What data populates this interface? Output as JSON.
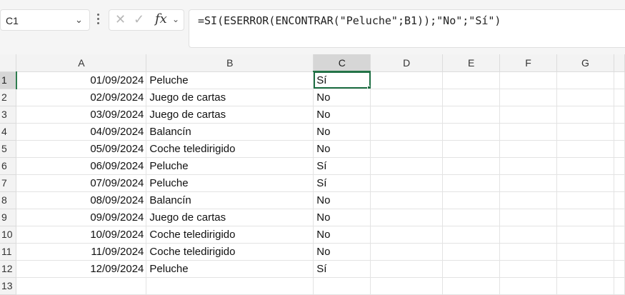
{
  "name_box": {
    "value": "C1",
    "chevron_icon": "chevron-down-icon"
  },
  "formula_controls": {
    "cancel_icon": "x-icon",
    "enter_icon": "checkmark-icon",
    "function_label": "fx",
    "chevron_icon": "chevron-down-icon"
  },
  "formula_bar": {
    "value": "=SI(ESERROR(ENCONTRAR(\"Peluche\";B1));\"No\";\"Sí\")"
  },
  "columns": [
    "A",
    "B",
    "C",
    "D",
    "E",
    "F",
    "G"
  ],
  "selected_column": "C",
  "selected_row": "1",
  "active_cell": "C1",
  "colors": {
    "selection_green": "#1e6e43",
    "header_bg": "#f3f3f3",
    "header_selected_bg": "#d6d6d6"
  },
  "rows": [
    {
      "num": "1",
      "A": "01/09/2024",
      "B": "Peluche",
      "C": "Sí"
    },
    {
      "num": "2",
      "A": "02/09/2024",
      "B": "Juego de cartas",
      "C": "No"
    },
    {
      "num": "3",
      "A": "03/09/2024",
      "B": "Juego de cartas",
      "C": "No"
    },
    {
      "num": "4",
      "A": "04/09/2024",
      "B": "Balancín",
      "C": "No"
    },
    {
      "num": "5",
      "A": "05/09/2024",
      "B": "Coche teledirigido",
      "C": "No"
    },
    {
      "num": "6",
      "A": "06/09/2024",
      "B": "Peluche",
      "C": "Sí"
    },
    {
      "num": "7",
      "A": "07/09/2024",
      "B": "Peluche",
      "C": "Sí"
    },
    {
      "num": "8",
      "A": "08/09/2024",
      "B": "Balancín",
      "C": "No"
    },
    {
      "num": "9",
      "A": "09/09/2024",
      "B": "Juego de cartas",
      "C": "No"
    },
    {
      "num": "10",
      "A": "10/09/2024",
      "B": "Coche teledirigido",
      "C": "No"
    },
    {
      "num": "11",
      "A": "11/09/2024",
      "B": "Coche teledirigido",
      "C": "No"
    },
    {
      "num": "12",
      "A": "12/09/2024",
      "B": "Peluche",
      "C": "Sí"
    },
    {
      "num": "13",
      "A": "",
      "B": "",
      "C": ""
    }
  ]
}
